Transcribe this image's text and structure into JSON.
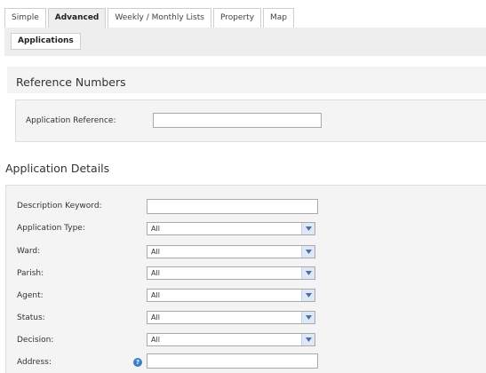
{
  "tabs": [
    {
      "label": "Simple",
      "active": false
    },
    {
      "label": "Advanced",
      "active": true
    },
    {
      "label": "Weekly / Monthly Lists",
      "active": false
    },
    {
      "label": "Property",
      "active": false
    },
    {
      "label": "Map",
      "active": false
    }
  ],
  "subtab": {
    "label": "Applications"
  },
  "reference_section": {
    "title": "Reference Numbers",
    "application_reference": {
      "label": "Application Reference:",
      "value": ""
    }
  },
  "details_section": {
    "title": "Application Details",
    "description_keyword": {
      "label": "Description Keyword:",
      "value": ""
    },
    "selects": [
      {
        "label": "Application Type:",
        "value": "All"
      },
      {
        "label": "Ward:",
        "value": "All"
      },
      {
        "label": "Parish:",
        "value": "All"
      },
      {
        "label": "Agent:",
        "value": "All"
      },
      {
        "label": "Status:",
        "value": "All"
      },
      {
        "label": "Decision:",
        "value": "All"
      }
    ],
    "address": {
      "label": "Address:",
      "value": "",
      "help_icon": "help-icon"
    }
  },
  "colors": {
    "panel_bg": "#f4f4f4",
    "tab_active_bg": "#eeeeee",
    "select_button_bg": "#dfe8f6",
    "help_icon": "#3b7fc4"
  }
}
